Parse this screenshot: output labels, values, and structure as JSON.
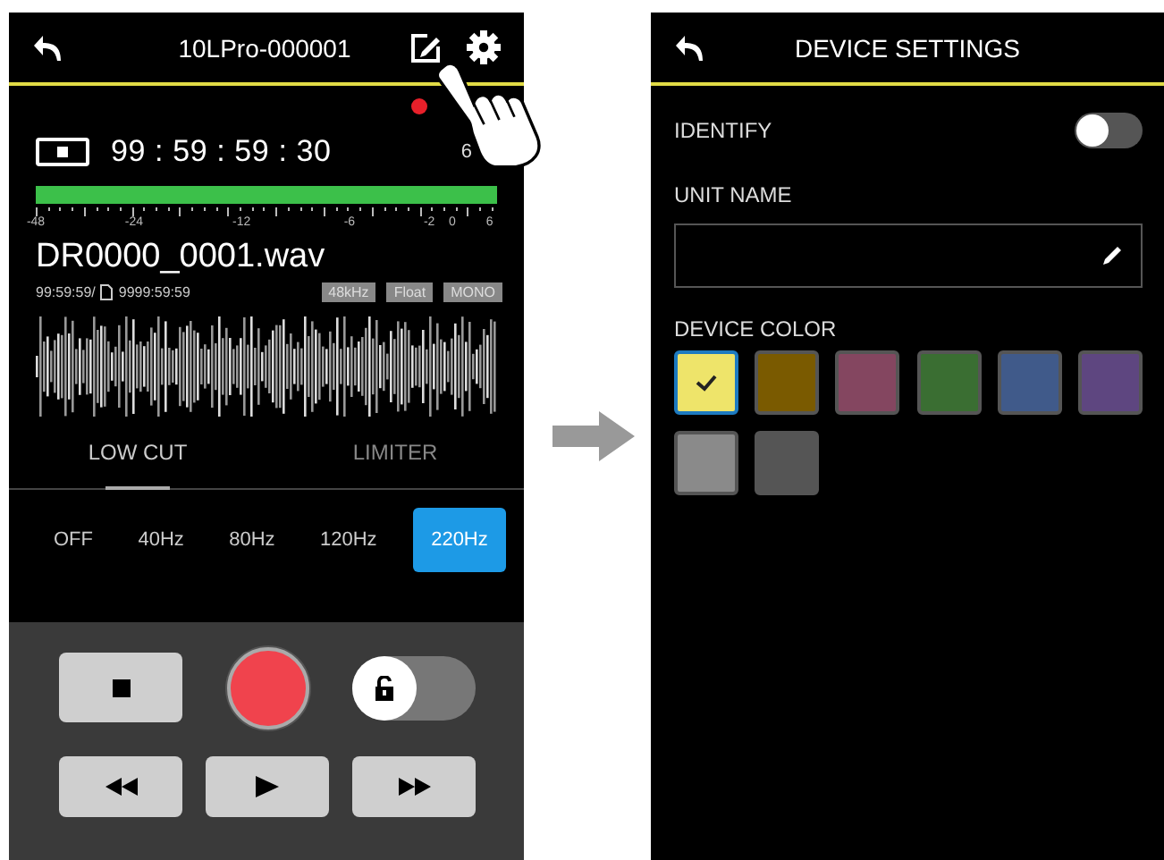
{
  "recorder": {
    "title": "10LPro-000001",
    "recording": true,
    "timecode": "99 : 59 : 59 : 30",
    "meter_edge": "6",
    "meter": {
      "level": 1
    },
    "scale": [
      "-48",
      "-24",
      "-12",
      "-6",
      "-2",
      "0",
      "6"
    ],
    "file_name": "DR0000_0001.wav",
    "elapsed": "99:59:59/",
    "remaining": "9999:59:59",
    "badges": [
      "48kHz",
      "Float",
      "MONO"
    ],
    "tabs": [
      {
        "label": "LOW CUT",
        "selected": true
      },
      {
        "label": "LIMITER",
        "selected": false
      }
    ],
    "low_cut": [
      {
        "label": "OFF",
        "selected": false
      },
      {
        "label": "40Hz",
        "selected": false
      },
      {
        "label": "80Hz",
        "selected": false
      },
      {
        "label": "120Hz",
        "selected": false
      },
      {
        "label": "220Hz",
        "selected": true
      }
    ],
    "lock": {
      "locked": false
    }
  },
  "settings": {
    "title": "DEVICE SETTINGS",
    "identify": {
      "label": "IDENTIFY",
      "on": false
    },
    "unit_name": {
      "label": "UNIT NAME"
    },
    "device_color": {
      "label": "DEVICE COLOR",
      "swatches": [
        {
          "color": "#eee46a",
          "selected": true
        },
        {
          "color": "#7a5a00",
          "selected": false
        },
        {
          "color": "#844660",
          "selected": false
        },
        {
          "color": "#3a6e32",
          "selected": false
        },
        {
          "color": "#405a8a",
          "selected": false
        },
        {
          "color": "#5e4680",
          "selected": false
        },
        {
          "color": "#8a8a8a",
          "selected": false
        },
        {
          "color": "#555555",
          "selected": false
        }
      ]
    }
  }
}
